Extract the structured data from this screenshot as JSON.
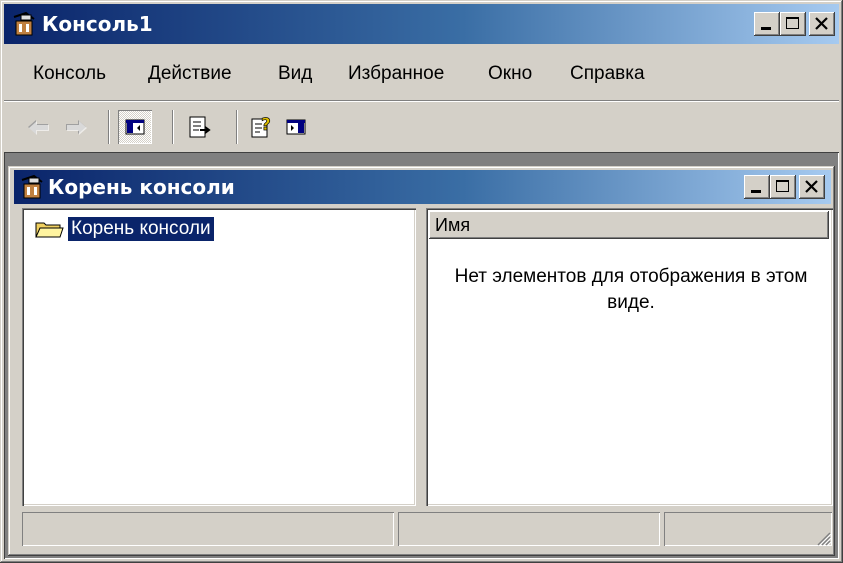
{
  "window": {
    "title": "Консоль1"
  },
  "menu": [
    "Консоль",
    "Действие",
    "Вид",
    "Избранное",
    "Окно",
    "Справка"
  ],
  "toolbar": {
    "buttons": [
      {
        "name": "back-arrow-icon"
      },
      {
        "name": "forward-arrow-icon"
      },
      {
        "name": "show-hide-tree-icon",
        "pressed": true
      },
      {
        "name": "export-list-icon"
      },
      {
        "name": "help-icon"
      },
      {
        "name": "show-hide-action-pane-icon"
      }
    ]
  },
  "child_window": {
    "title": "Корень консоли"
  },
  "tree": {
    "items": [
      {
        "label": "Корень консоли",
        "icon": "folder-icon",
        "selected": true
      }
    ]
  },
  "list": {
    "columns": [
      "Имя"
    ],
    "empty_message": "Нет элементов для отображения в этом виде."
  },
  "colors": {
    "title_active_start": "#0a246a",
    "title_active_end": "#a6caf0",
    "face": "#d4d0c8",
    "selection": "#0a246a"
  }
}
